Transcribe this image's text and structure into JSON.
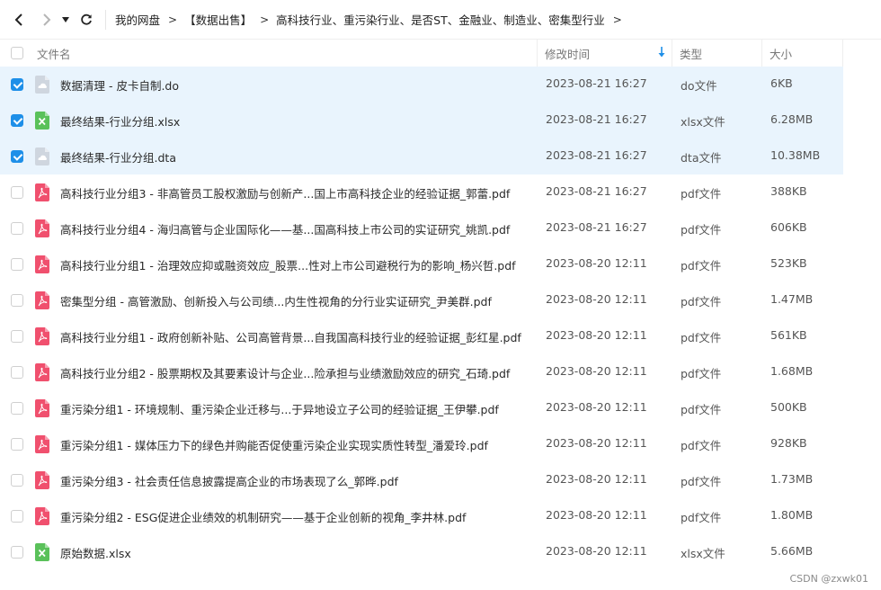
{
  "toolbar": {
    "back_icon": "chevron-left-icon",
    "forward_icon": "chevron-right-icon",
    "dropdown_icon": "caret-down-icon",
    "refresh_icon": "refresh-icon"
  },
  "breadcrumb": {
    "items": [
      "我的网盘",
      "【数据出售】",
      "高科技行业、重污染行业、是否ST、金融业、制造业、密集型行业"
    ],
    "separator": ">"
  },
  "columns": {
    "name": "文件名",
    "time": "修改时间",
    "type": "类型",
    "size": "大小"
  },
  "colors": {
    "accent": "#1e8fe8",
    "selected_row": "#e9f4fd",
    "pdf": "#f0506e",
    "xlsx": "#5ac15a",
    "generic": "#cfd6df"
  },
  "files": [
    {
      "name": "数据清理 - 皮卡自制.do",
      "time": "2023-08-21 16:27",
      "type": "do文件",
      "size": "6KB",
      "icon": "generic-file-icon",
      "selected": true
    },
    {
      "name": "最终结果-行业分组.xlsx",
      "time": "2023-08-21 16:27",
      "type": "xlsx文件",
      "size": "6.28MB",
      "icon": "excel-file-icon",
      "selected": true
    },
    {
      "name": "最终结果-行业分组.dta",
      "time": "2023-08-21 16:27",
      "type": "dta文件",
      "size": "10.38MB",
      "icon": "generic-file-icon",
      "selected": true
    },
    {
      "name": "高科技行业分组3 - 非高管员工股权激励与创新产...国上市高科技企业的经验证据_郭蕾.pdf",
      "time": "2023-08-21 16:27",
      "type": "pdf文件",
      "size": "388KB",
      "icon": "pdf-file-icon",
      "selected": false
    },
    {
      "name": "高科技行业分组4 - 海归高管与企业国际化——基...国高科技上市公司的实证研究_姚凯.pdf",
      "time": "2023-08-21 16:27",
      "type": "pdf文件",
      "size": "606KB",
      "icon": "pdf-file-icon",
      "selected": false
    },
    {
      "name": "高科技行业分组1 - 治理效应抑或融资效应_股票...性对上市公司避税行为的影响_杨兴哲.pdf",
      "time": "2023-08-20 12:11",
      "type": "pdf文件",
      "size": "523KB",
      "icon": "pdf-file-icon",
      "selected": false
    },
    {
      "name": "密集型分组 - 高管激励、创新投入与公司绩...内生性视角的分行业实证研究_尹美群.pdf",
      "time": "2023-08-20 12:11",
      "type": "pdf文件",
      "size": "1.47MB",
      "icon": "pdf-file-icon",
      "selected": false
    },
    {
      "name": "高科技行业分组1 - 政府创新补贴、公司高管背景...自我国高科技行业的经验证据_彭红星.pdf",
      "time": "2023-08-20 12:11",
      "type": "pdf文件",
      "size": "561KB",
      "icon": "pdf-file-icon",
      "selected": false
    },
    {
      "name": "高科技行业分组2 - 股票期权及其要素设计与企业...险承担与业绩激励效应的研究_石琦.pdf",
      "time": "2023-08-20 12:11",
      "type": "pdf文件",
      "size": "1.68MB",
      "icon": "pdf-file-icon",
      "selected": false
    },
    {
      "name": "重污染分组1 - 环境规制、重污染企业迁移与...于异地设立子公司的经验证据_王伊攀.pdf",
      "time": "2023-08-20 12:11",
      "type": "pdf文件",
      "size": "500KB",
      "icon": "pdf-file-icon",
      "selected": false
    },
    {
      "name": "重污染分组1 - 媒体压力下的绿色并购能否促使重污染企业实现实质性转型_潘爱玲.pdf",
      "time": "2023-08-20 12:11",
      "type": "pdf文件",
      "size": "928KB",
      "icon": "pdf-file-icon",
      "selected": false
    },
    {
      "name": "重污染分组3 - 社会责任信息披露提高企业的市场表现了么_郭晔.pdf",
      "time": "2023-08-20 12:11",
      "type": "pdf文件",
      "size": "1.73MB",
      "icon": "pdf-file-icon",
      "selected": false
    },
    {
      "name": "重污染分组2 - ESG促进企业绩效的机制研究——基于企业创新的视角_李井林.pdf",
      "time": "2023-08-20 12:11",
      "type": "pdf文件",
      "size": "1.80MB",
      "icon": "pdf-file-icon",
      "selected": false
    },
    {
      "name": "原始数据.xlsx",
      "time": "2023-08-20 12:11",
      "type": "xlsx文件",
      "size": "5.66MB",
      "icon": "excel-file-icon",
      "selected": false
    }
  ],
  "watermark": "CSDN @zxwk01"
}
